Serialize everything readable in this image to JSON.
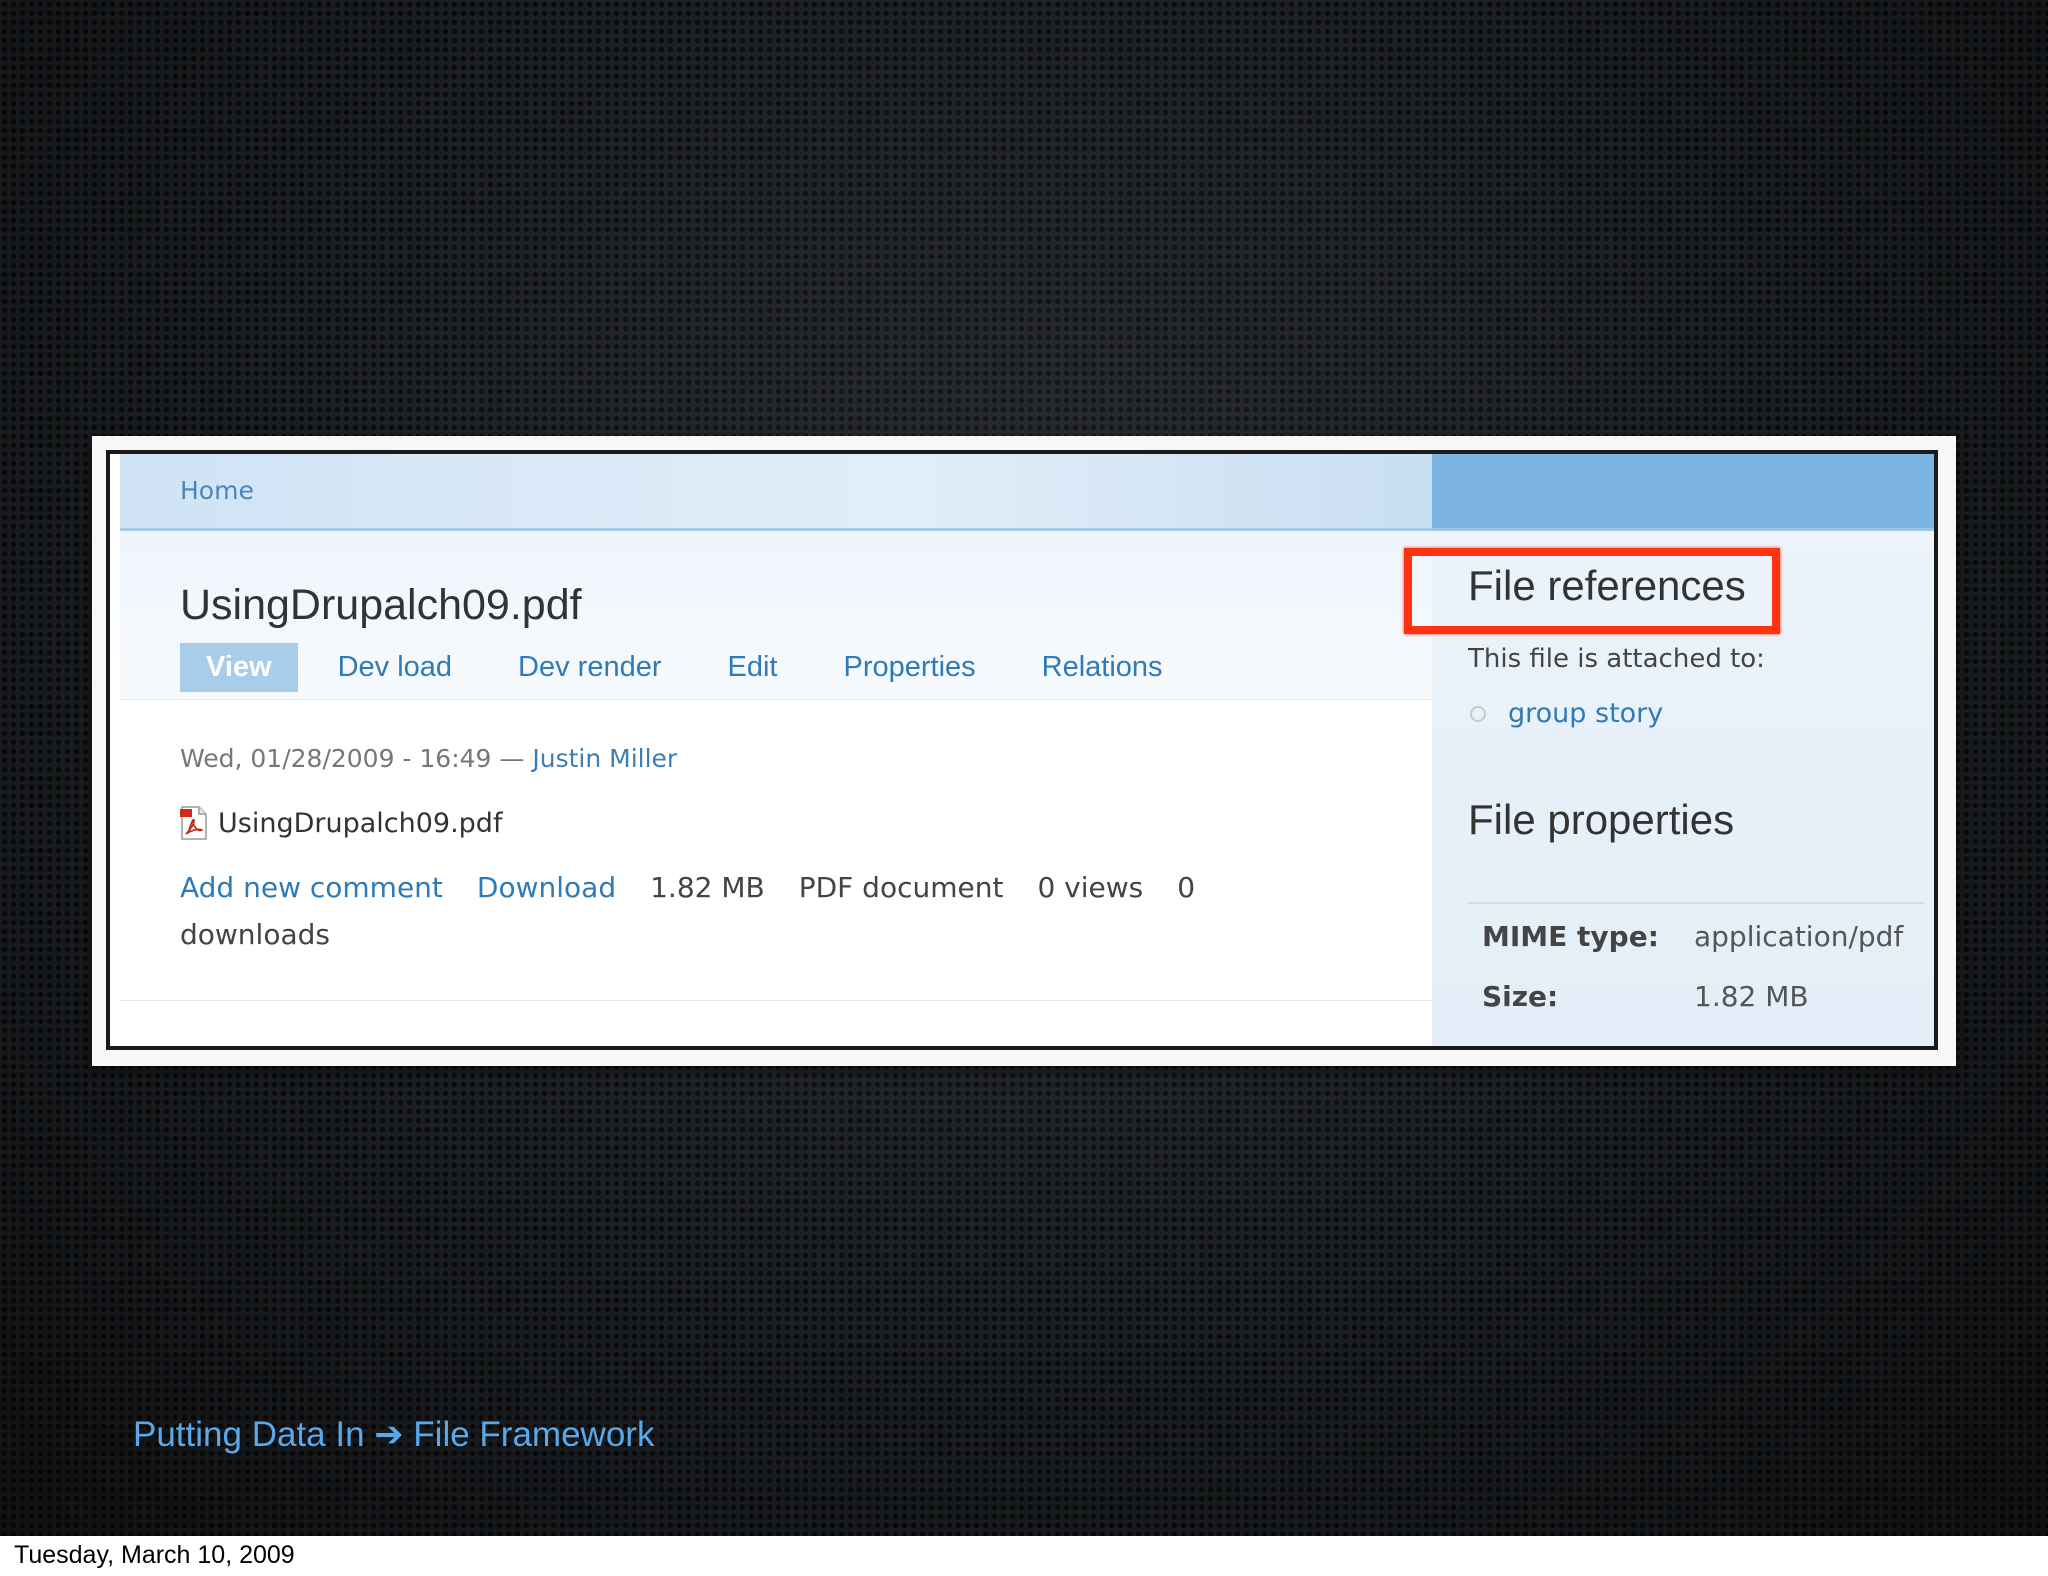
{
  "breadcrumb": {
    "home": "Home"
  },
  "node": {
    "title": "UsingDrupalch09.pdf",
    "tabs": [
      {
        "label": "View",
        "active": true
      },
      {
        "label": "Dev load"
      },
      {
        "label": "Dev render"
      },
      {
        "label": "Edit"
      },
      {
        "label": "Properties"
      },
      {
        "label": "Relations"
      }
    ],
    "submitted": "Wed, 01/28/2009 - 16:49 —",
    "author": "Justin Miller",
    "file_name": "UsingDrupalch09.pdf",
    "file_icon": "pdf-file-icon",
    "links": {
      "add_comment": "Add new comment",
      "download": "Download",
      "size": "1.82 MB",
      "type": "PDF document",
      "views": "0 views",
      "downloads": "0 downloads"
    }
  },
  "sidebar": {
    "references_title": "File references",
    "attached_text": "This file is attached to:",
    "references": [
      "group story"
    ],
    "properties_title": "File properties",
    "properties": [
      {
        "key": "MIME type:",
        "value": "application/pdf"
      },
      {
        "key": "Size:",
        "value": "1.82 MB"
      }
    ]
  },
  "slide": {
    "caption": "Putting Data In ➔ File Framework",
    "date": "Tuesday, March 10, 2009"
  },
  "colors": {
    "link": "#2f7ab8",
    "highlight": "#ff3311",
    "caption": "#5aa8ea"
  }
}
